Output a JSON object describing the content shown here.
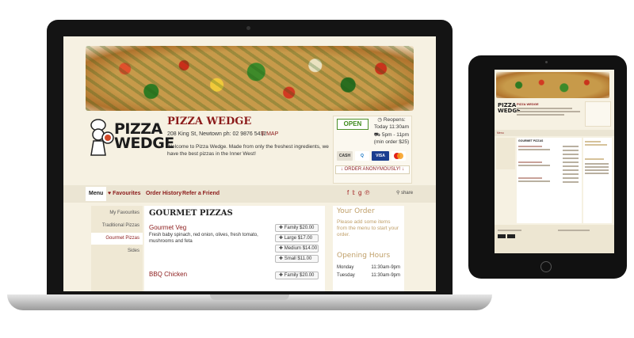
{
  "restaurant": {
    "logo_text": [
      "PIZZA",
      "WEDGE"
    ],
    "name": "PIZZA WEDGE",
    "address": "208 King St, Newtown ph: 02 9876 5432",
    "map_label": "MAP",
    "welcome": "Welcome to Pizza Wedge. Made from only the freshest ingredients, we have the best pizzas in the Inner West!"
  },
  "status": {
    "open_label": "OPEN",
    "reopens": [
      "Reopens:",
      "Today 11:30am"
    ],
    "delivery": [
      "5pm - 11pm",
      "(min order $25)"
    ],
    "payment_methods": [
      "CASH",
      "Q",
      "VISA",
      "MC"
    ],
    "order_anon_label": "ORDER ANONYMOUSLY!"
  },
  "nav": {
    "tabs": [
      {
        "label": "Menu",
        "active": true
      },
      {
        "label": "Favourites",
        "active": false
      },
      {
        "label": "Order History",
        "active": false
      },
      {
        "label": "Refer a Friend",
        "active": false
      }
    ],
    "social_icons": [
      "facebook-icon",
      "twitter-icon",
      "googleplus-icon",
      "pinterest-icon"
    ],
    "share_label": "share"
  },
  "categories": [
    {
      "label": "My Favourites",
      "active": false
    },
    {
      "label": "Traditional Pizzas",
      "active": false
    },
    {
      "label": "Gourmet Pizzas",
      "active": true
    },
    {
      "label": "Sides",
      "active": false
    }
  ],
  "menu": {
    "section_title": "GOURMET PIZZAS",
    "items": [
      {
        "name": "Gourmet Veg",
        "description": "Fresh baby spinach, red onion, olives, fresh tomato, mushrooms and feta",
        "sizes": [
          "Family $20.00",
          "Large $17.00",
          "Medium $14.00",
          "Small $11.00"
        ]
      },
      {
        "name": "BBQ Chicken",
        "description": "",
        "sizes": [
          "Family $20.00"
        ]
      }
    ]
  },
  "order": {
    "title": "Your Order",
    "empty_message": "Please add some items from the menu to start your order."
  },
  "hours": {
    "title": "Opening Hours",
    "rows": [
      {
        "day": "Monday",
        "time": "11:30am-9pm"
      },
      {
        "day": "Tuesday",
        "time": "11:30am-9pm"
      }
    ]
  },
  "colors": {
    "brand_red": "#8b1a1a",
    "open_green": "#3d8a1c",
    "page_bg": "#f6f1e2",
    "accent_tan": "#c0a06a"
  }
}
